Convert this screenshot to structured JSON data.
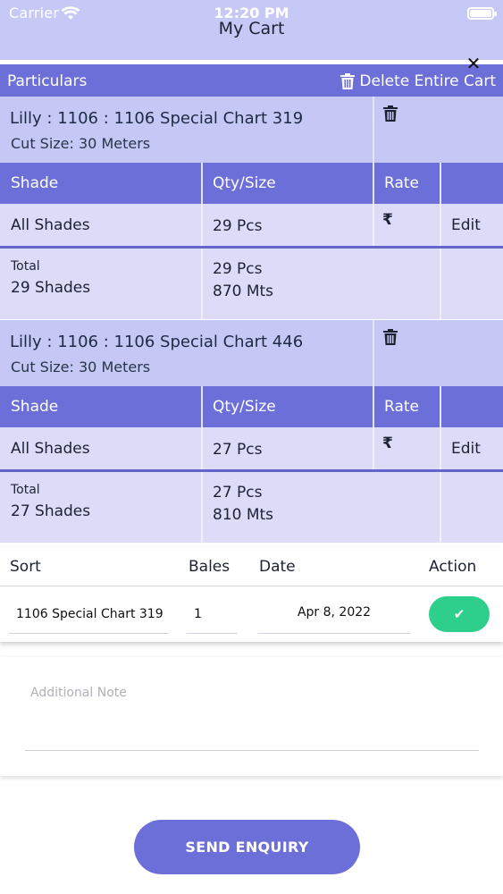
{
  "status_bar": {
    "carrier": "Carrier",
    "time": "12:20 PM"
  },
  "header": {
    "title": "My Cart",
    "close_symbol": "✕"
  },
  "cart": {
    "particulars_label": "Particulars",
    "delete_all_label": "Delete Entire Cart",
    "columns": {
      "shade": "Shade",
      "qty": "Qty/Size",
      "rate": "Rate"
    },
    "items": [
      {
        "title": "Lilly : 1106 : 1106 Special Chart 319",
        "cut_size": "Cut Size: 30 Meters",
        "row": {
          "shade": "All Shades",
          "qty": "29 Pcs",
          "rate_symbol": "₹",
          "edit": "Edit"
        },
        "total": {
          "label": "Total",
          "shades": "29 Shades",
          "pcs": "29 Pcs",
          "mts": "870 Mts"
        }
      },
      {
        "title": "Lilly : 1106 : 1106 Special Chart 446",
        "cut_size": "Cut Size: 30 Meters",
        "row": {
          "shade": "All Shades",
          "qty": "27 Pcs",
          "rate_symbol": "₹",
          "edit": "Edit"
        },
        "total": {
          "label": "Total",
          "shades": "27 Shades",
          "pcs": "27 Pcs",
          "mts": "810 Mts"
        }
      }
    ]
  },
  "order_form": {
    "headers": {
      "sort": "Sort",
      "bales": "Bales",
      "date": "Date",
      "action": "Action"
    },
    "values": {
      "sort": "1106 Special Chart 319",
      "bales": "1",
      "date": "Apr 8, 2022"
    },
    "action_symbol": "✔"
  },
  "note": {
    "placeholder": "Additional Note"
  },
  "send_button": "SEND ENQUIRY",
  "colors": {
    "primary": "#6d6fd8",
    "header_bg": "#c6c8f6",
    "item_bg": "#c5c8f5",
    "row_bg": "#dcdcf8",
    "accent_green": "#2ecf8c"
  }
}
